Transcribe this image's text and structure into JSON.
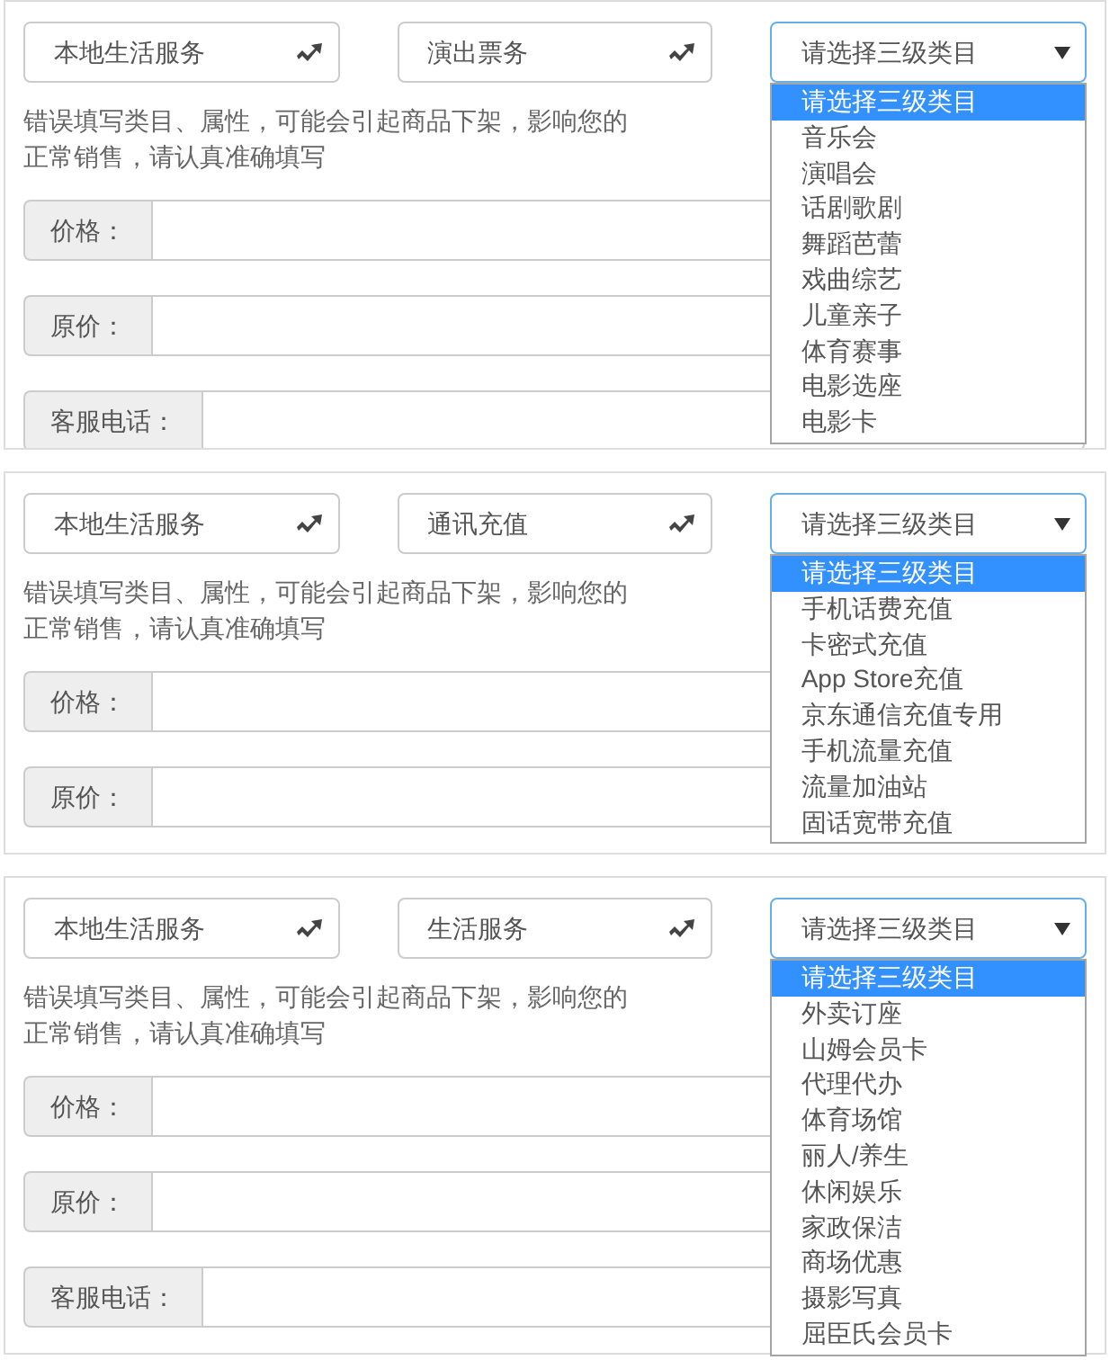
{
  "panels": [
    {
      "selects": [
        {
          "value": "本地生活服务",
          "kind": "picker"
        },
        {
          "value": "演出票务",
          "kind": "picker"
        },
        {
          "value": "请选择三级类目",
          "kind": "dropdown",
          "expanded": true
        }
      ],
      "warning": "错误填写类目、属性，可能会引起商品下架，影响您的正常销售，请认真准确填写",
      "fields": [
        {
          "label": "价格："
        },
        {
          "label": "原价："
        },
        {
          "label": "客服电话："
        }
      ],
      "options": [
        {
          "label": "请选择三级类目",
          "selected": true
        },
        {
          "label": "音乐会",
          "selected": false
        },
        {
          "label": "演唱会",
          "selected": false
        },
        {
          "label": "话剧歌剧",
          "selected": false
        },
        {
          "label": "舞蹈芭蕾",
          "selected": false
        },
        {
          "label": "戏曲综艺",
          "selected": false
        },
        {
          "label": "儿童亲子",
          "selected": false
        },
        {
          "label": "体育赛事",
          "selected": false
        },
        {
          "label": "电影选座",
          "selected": false
        },
        {
          "label": "电影卡",
          "selected": false
        }
      ]
    },
    {
      "selects": [
        {
          "value": "本地生活服务",
          "kind": "picker"
        },
        {
          "value": "通讯充值",
          "kind": "picker"
        },
        {
          "value": "请选择三级类目",
          "kind": "dropdown",
          "expanded": true
        }
      ],
      "warning": "错误填写类目、属性，可能会引起商品下架，影响您的正常销售，请认真准确填写",
      "fields": [
        {
          "label": "价格："
        },
        {
          "label": "原价："
        }
      ],
      "options": [
        {
          "label": "请选择三级类目",
          "selected": true
        },
        {
          "label": "手机话费充值",
          "selected": false
        },
        {
          "label": "卡密式充值",
          "selected": false
        },
        {
          "label": "App Store充值",
          "selected": false
        },
        {
          "label": "京东通信充值专用",
          "selected": false
        },
        {
          "label": "手机流量充值",
          "selected": false
        },
        {
          "label": "流量加油站",
          "selected": false
        },
        {
          "label": "固话宽带充值",
          "selected": false
        }
      ]
    },
    {
      "selects": [
        {
          "value": "本地生活服务",
          "kind": "picker"
        },
        {
          "value": "生活服务",
          "kind": "picker"
        },
        {
          "value": "请选择三级类目",
          "kind": "dropdown",
          "expanded": true
        }
      ],
      "warning": "错误填写类目、属性，可能会引起商品下架，影响您的正常销售，请认真准确填写",
      "fields": [
        {
          "label": "价格："
        },
        {
          "label": "原价："
        },
        {
          "label": "客服电话："
        }
      ],
      "options": [
        {
          "label": "请选择三级类目",
          "selected": true
        },
        {
          "label": "外卖订座",
          "selected": false
        },
        {
          "label": "山姆会员卡",
          "selected": false
        },
        {
          "label": "代理代办",
          "selected": false
        },
        {
          "label": "体育场馆",
          "selected": false
        },
        {
          "label": "丽人/养生",
          "selected": false
        },
        {
          "label": "休闲娱乐",
          "selected": false
        },
        {
          "label": "家政保洁",
          "selected": false
        },
        {
          "label": "商场优惠",
          "selected": false
        },
        {
          "label": "摄影写真",
          "selected": false
        },
        {
          "label": "屈臣氏会员卡",
          "selected": false
        }
      ]
    }
  ]
}
